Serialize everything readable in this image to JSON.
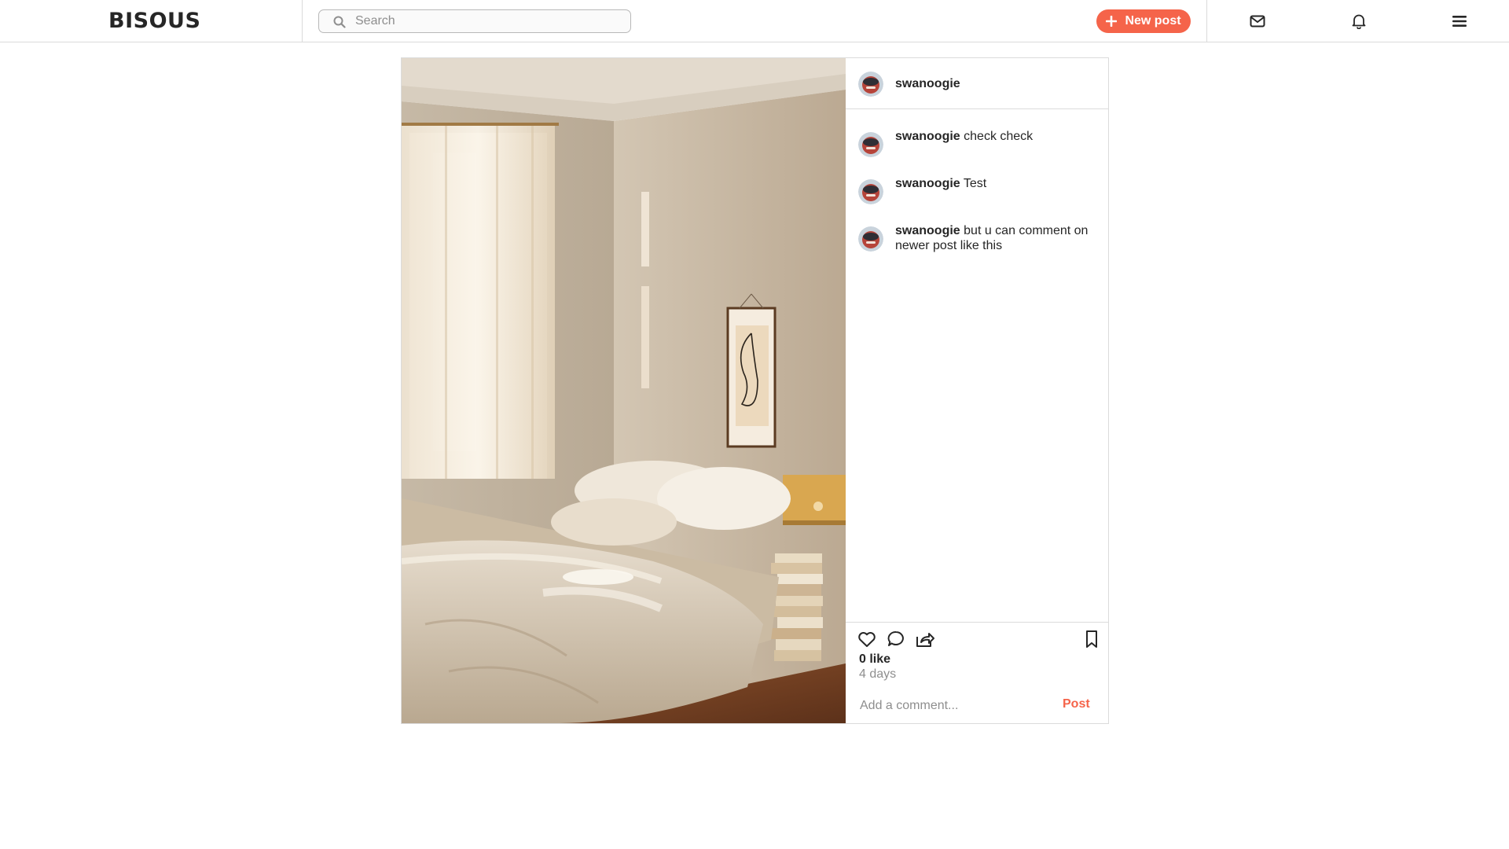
{
  "header": {
    "logo": "BISOUS",
    "search_placeholder": "Search",
    "new_post_label": "New post",
    "icons": [
      "mail-icon",
      "bell-icon",
      "menu-icon"
    ]
  },
  "post": {
    "author": "swanoogie",
    "comments": [
      {
        "user": "swanoogie",
        "text": "check check"
      },
      {
        "user": "swanoogie",
        "text": "Test"
      },
      {
        "user": "swanoogie",
        "text": "but u can comment on newer post like this"
      }
    ],
    "likes_label": "0 like",
    "age_label": "4 days",
    "comment_placeholder": "Add a comment...",
    "post_button_label": "Post"
  },
  "colors": {
    "accent": "#f5644a",
    "border": "#dbdbdb",
    "text": "#262626",
    "muted": "#8e8e8e"
  }
}
